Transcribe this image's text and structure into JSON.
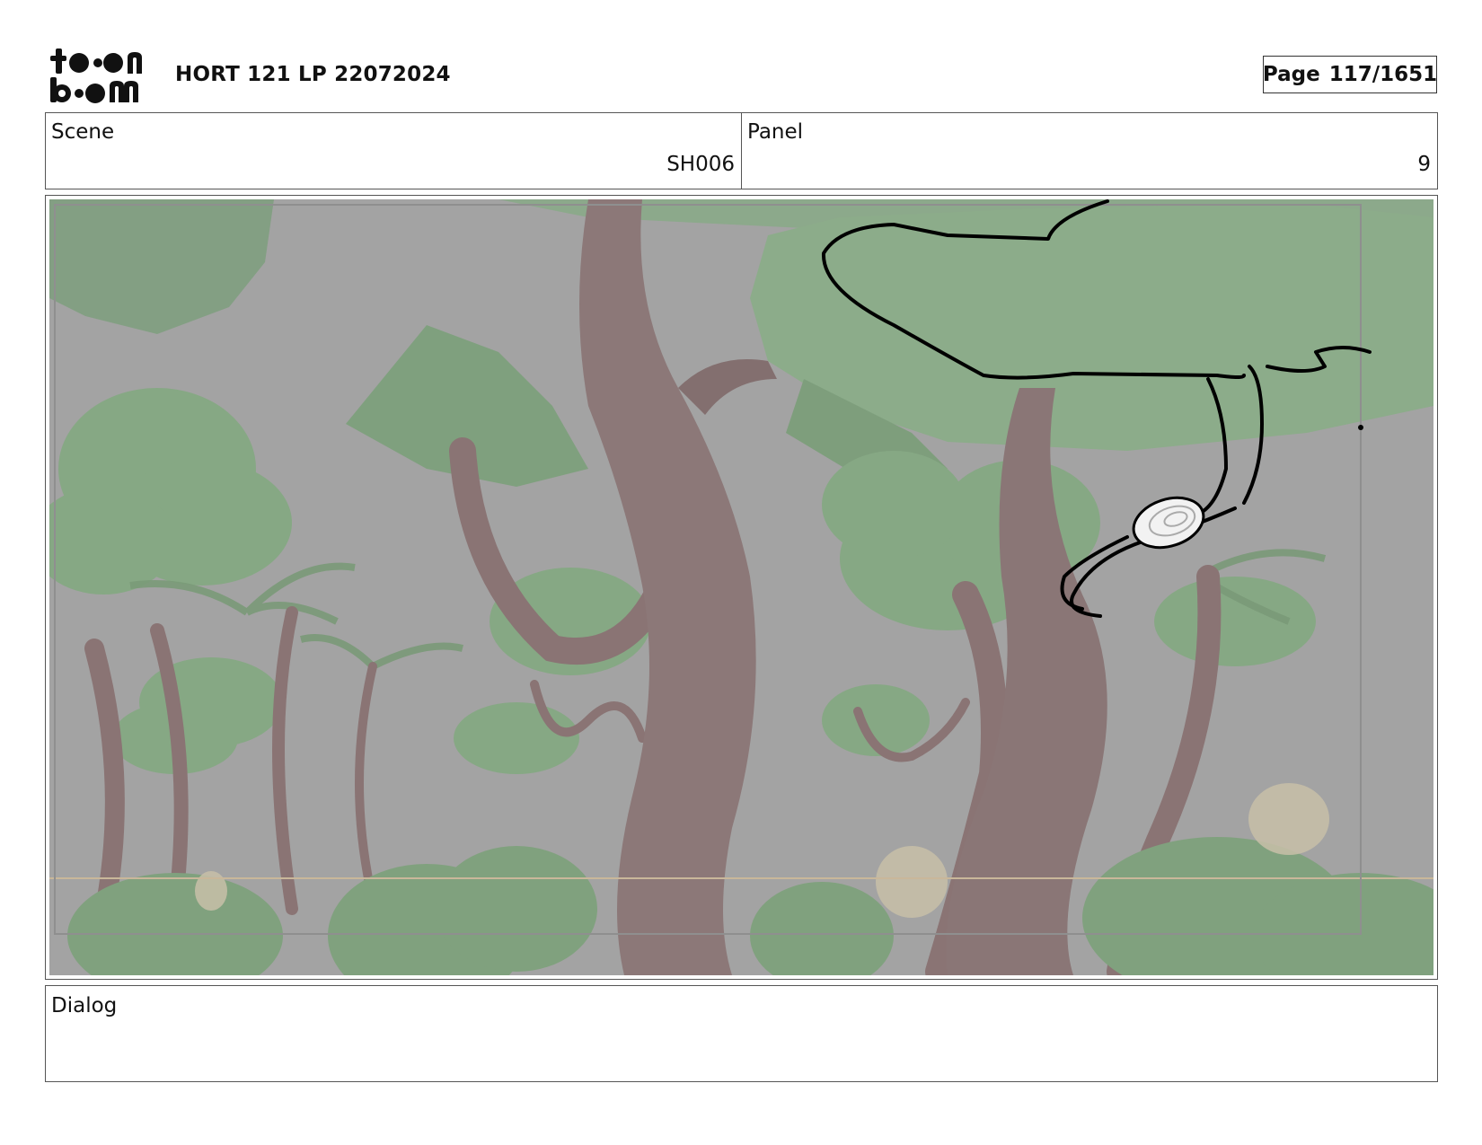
{
  "header": {
    "logo_text": "toon boom",
    "project_title": "HORT 121 LP 22072024",
    "page_label": "Page",
    "page_number": "117/1651"
  },
  "scene": {
    "label": "Scene",
    "value": "SH006"
  },
  "panel": {
    "label": "Panel",
    "value": "9"
  },
  "dialog": {
    "label": "Dialog",
    "value": ""
  },
  "colors": {
    "background_gray": "#a6a6a6",
    "foliage_green": "#84a684",
    "trunk_brown": "#8c7878",
    "sketch_line": "#000000"
  }
}
